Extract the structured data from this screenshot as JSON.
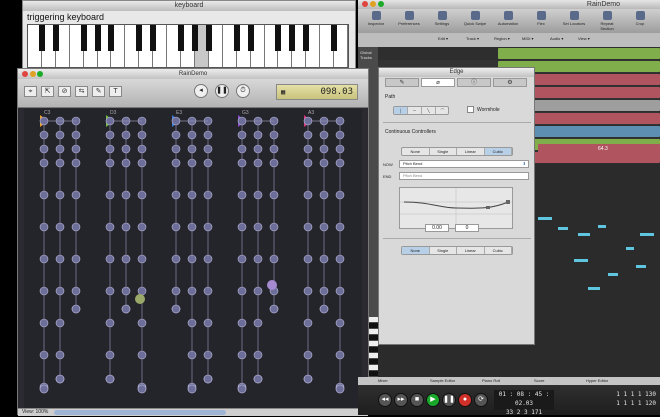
{
  "keyboard_window": {
    "title": "keyboard",
    "label": "triggering keyboard"
  },
  "daw": {
    "title": "RainDemo",
    "toolbar": [
      {
        "label": "Inspector",
        "icon": "info-icon"
      },
      {
        "label": "Preferences",
        "icon": "switch-icon"
      },
      {
        "label": "Settings",
        "icon": "gear-icon"
      },
      {
        "label": "Quick Swipe",
        "icon": "swipe-icon"
      },
      {
        "label": "Automation",
        "icon": "automation-icon"
      },
      {
        "label": "Flex",
        "icon": "flex-icon"
      },
      {
        "label": "Set Locators",
        "icon": "locators-icon"
      },
      {
        "label": "Repeat Section",
        "icon": "repeat-icon"
      },
      {
        "label": "Crop",
        "icon": "crop-icon"
      }
    ],
    "bar2": [
      "Edit",
      "Track",
      "Region",
      "MIDI",
      "Audio",
      "View"
    ],
    "global_tracks": "Global Tracks",
    "region_label": "64.3",
    "bottom_tabs": [
      "Mixer",
      "Sample Editor",
      "Piano Roll",
      "Score",
      "Hyper Editor"
    ],
    "position": {
      "line1": "01 : 08 : 45 : 02.03",
      "line2": "33   2   3   171"
    },
    "tempo": {
      "line1": "1   1   1   1   130",
      "line2": "1   1   1   1   120"
    }
  },
  "edge_panel": {
    "title": "Edge",
    "tabs": [
      "pencil-icon",
      "eyedropper-icon",
      "info-icon",
      "gear-icon"
    ],
    "path_label": "Path",
    "wormhole_label": "Wormhole",
    "cc_label": "Continuous Controllers",
    "curve_modes": [
      "None",
      "Single",
      "Linear",
      "Cubic"
    ],
    "selected_curve": "Cubic",
    "row1_label": "NOW",
    "row1_value": "Pitch Bend",
    "row2_label": "END",
    "row2_value": "Pitch Bend",
    "field1": "0.00",
    "field2": "0",
    "bottom_modes": [
      "None",
      "Single",
      "Linear",
      "Cubic"
    ]
  },
  "rain_window": {
    "title": "RainDemo",
    "tools": [
      "⌖",
      "⇱",
      "⊘",
      "⇆",
      "✎",
      "T"
    ],
    "lcd": "098.03",
    "zoom": "View: 100%",
    "column_labels": [
      "C3",
      "D3",
      "E3",
      "G3",
      "A3"
    ],
    "colors": {
      "orange": "#f0a020",
      "green": "#6fbf3a",
      "blue": "#3a7bd5",
      "purple": "#8a4ad0",
      "pink": "#e03080"
    }
  }
}
